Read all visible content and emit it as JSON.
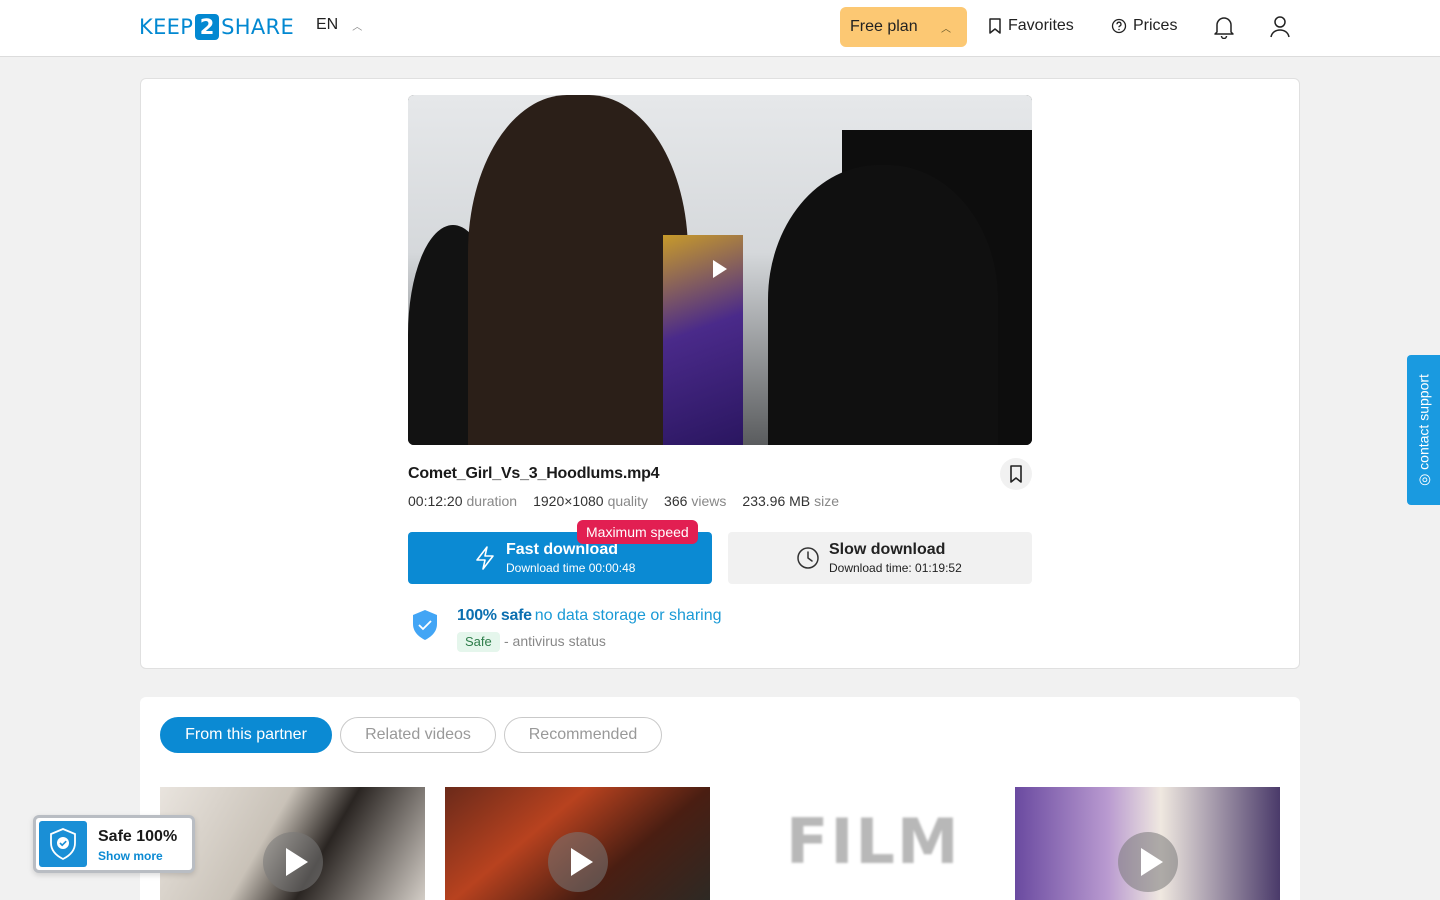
{
  "header": {
    "logo_left": "KEEP",
    "logo_mid": "2",
    "logo_right": "SHARE",
    "lang": "EN",
    "plan_label": "Free plan",
    "favorites_label": "Favorites",
    "prices_label": "Prices"
  },
  "file": {
    "title": "Comet_Girl_Vs_3_Hoodlums.mp4",
    "duration_value": "00:12:20",
    "duration_label": "duration",
    "quality_value": "1920×1080",
    "quality_label": "quality",
    "views_value": "366",
    "views_label": "views",
    "size_value": "233.96 MB",
    "size_label": "size"
  },
  "download": {
    "fast_title": "Fast download",
    "fast_sub": "Download time 00:00:48",
    "max_badge": "Maximum speed",
    "slow_title": "Slow download",
    "slow_sub": "Download time: 01:19:52"
  },
  "safety": {
    "strong": "100% safe",
    "rest": "no data storage or sharing",
    "tag": "Safe",
    "status": "- antivirus status"
  },
  "tabs": [
    {
      "label": "From this partner",
      "active": true
    },
    {
      "label": "Related videos",
      "active": false
    },
    {
      "label": "Recommended",
      "active": false
    }
  ],
  "thumbs": {
    "film_text": "FILM"
  },
  "widget": {
    "title": "Safe 100%",
    "link": "Show more"
  },
  "contact": {
    "label": "◎ contact support"
  },
  "colors": {
    "accent": "#0b8ad3",
    "plan": "#fcc873",
    "badge": "#e21f52"
  }
}
